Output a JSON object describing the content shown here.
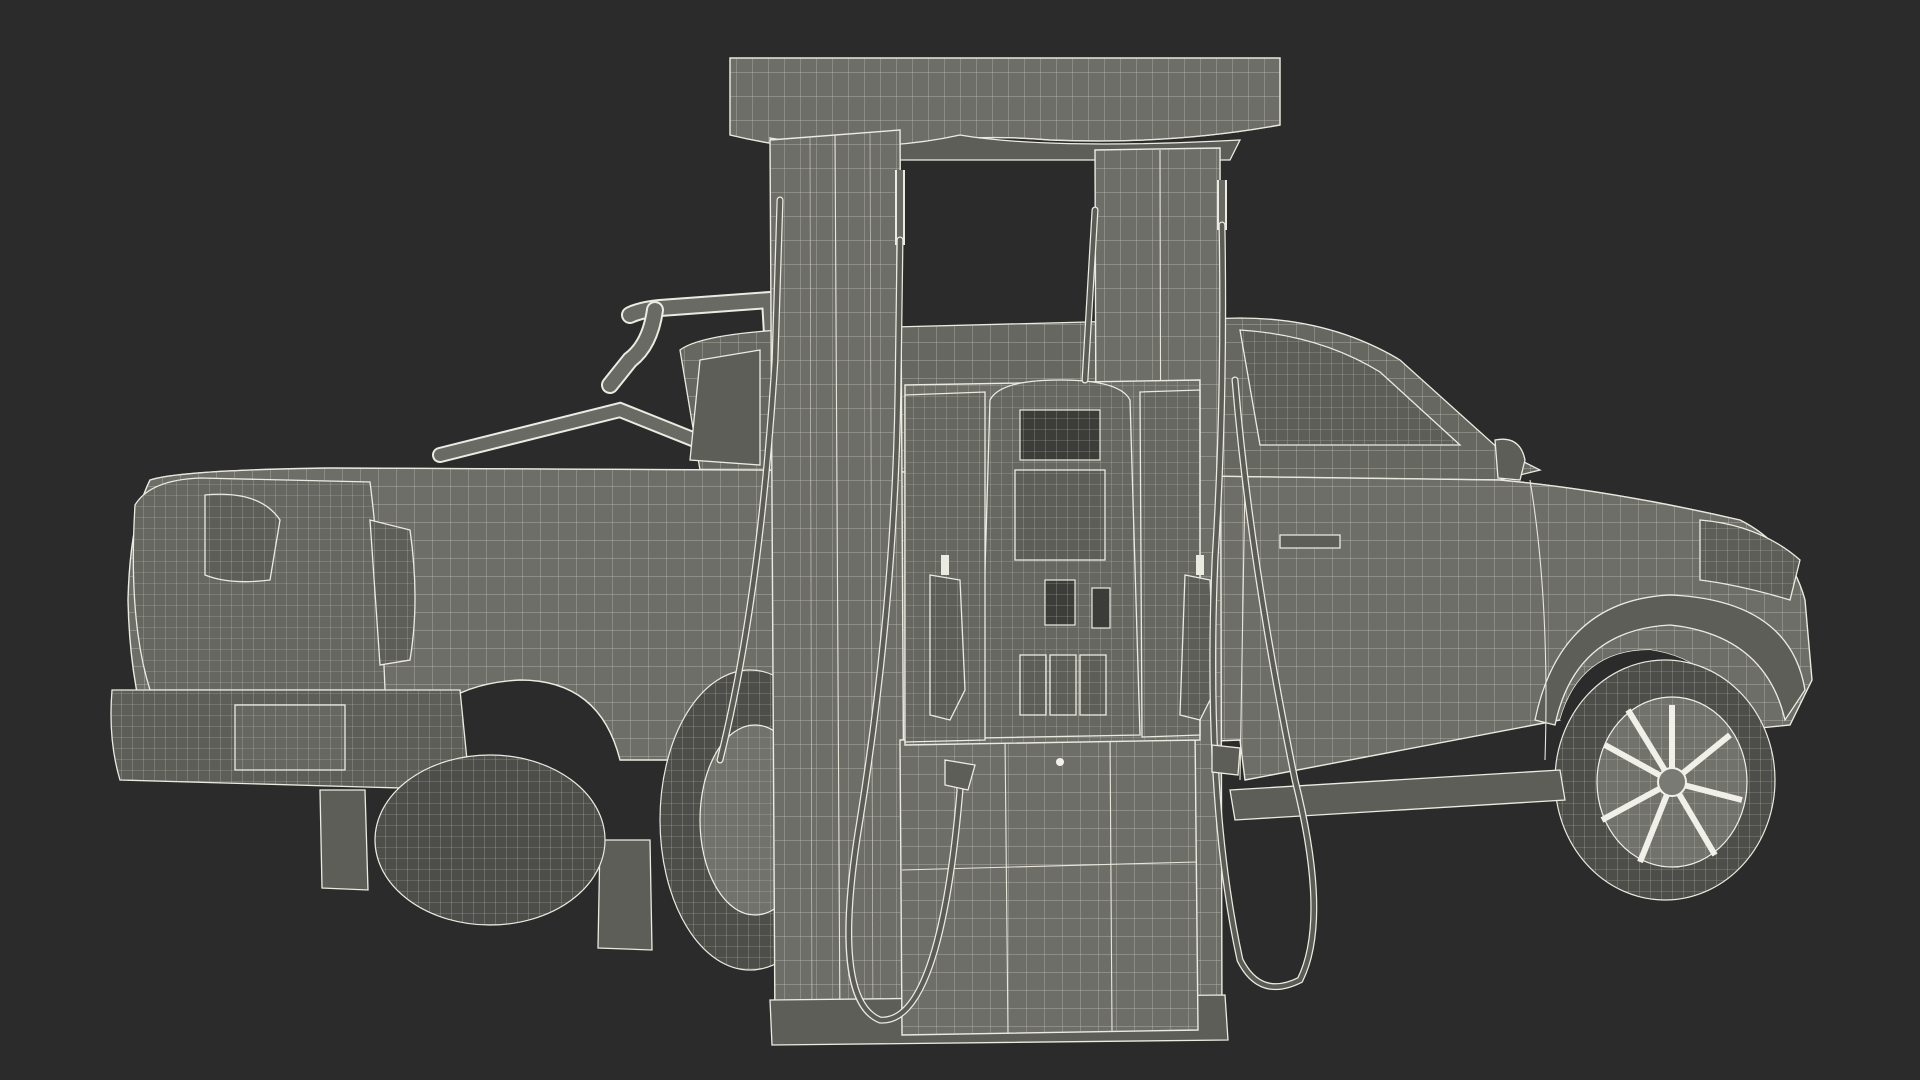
{
  "scene": {
    "background_color": "#2b2b2b",
    "wire_color": "#e9e7dc",
    "surface_color": "#6e6e69",
    "subject_icons": [
      "fuel-pump-icon",
      "pickup-truck-icon"
    ]
  }
}
